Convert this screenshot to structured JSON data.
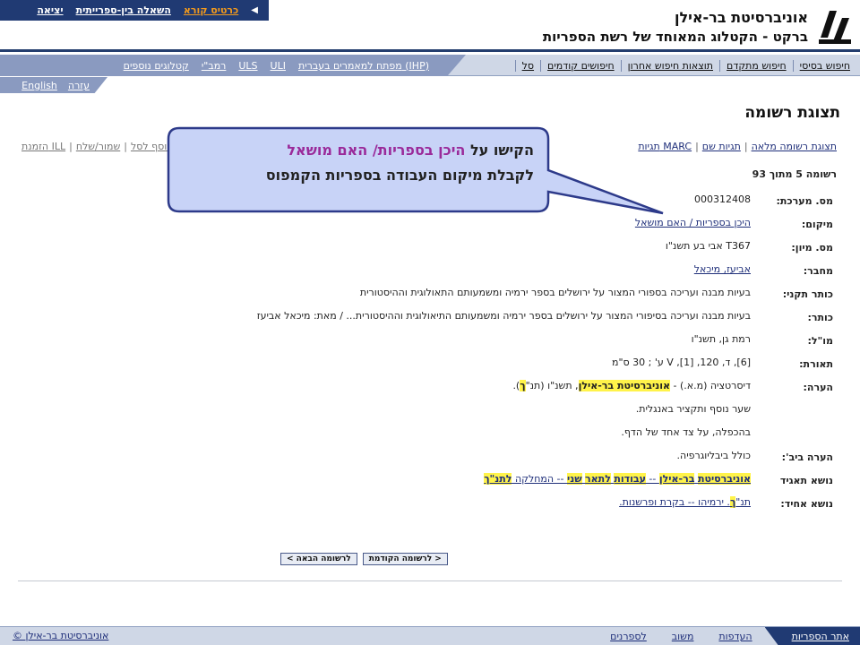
{
  "top_links": [
    {
      "label": "כרטיס קורא",
      "active": true
    },
    {
      "label": "השאלה בין-ספרייתית",
      "active": false
    },
    {
      "label": "יציאה",
      "active": false
    }
  ],
  "header": {
    "university": "אוניברסיטת בר-אילן",
    "subtitle": "ברקט - הקטלוג המאוחד של רשת הספריות"
  },
  "nav_right": [
    "חיפוש בסיסי",
    "חיפוש מתקדם",
    "תוצאות חיפוש אחרון",
    "חיפושים קודמים",
    "סל"
  ],
  "nav_left": [
    "מפתח למאמרים בעברית (IHP)",
    "ULI",
    "ULS",
    "רמב\"י",
    "קטלוגים נוספים"
  ],
  "lang_bar": [
    "עזרה",
    "English"
  ],
  "page_title": "תצוגת רשומה",
  "record_actions": [
    "תצוגת רשומה מלאה",
    "תגיות שם",
    "תגיות MARC"
  ],
  "record_actions_left": [
    "הזמנת ILL",
    "שמור/שלח",
    "הוסף לסל"
  ],
  "record_count": "רשומה 5 מתוך 93",
  "fields": [
    {
      "label": "מס. מערכת:",
      "value": "000312408"
    },
    {
      "label": "מיקום:",
      "value": "היכן בספריות / האם מושאל",
      "link": true
    },
    {
      "label": "מס. מיון:",
      "value": "T367 אבי בע תשנ\"ו"
    },
    {
      "label": "מחבר:",
      "value": "אביעז, מיכאל",
      "link": true
    },
    {
      "label": "כותר תקני:",
      "value": "בעיות מבנה ועריכה בספורי המצור על ירושלים בספר ירמיה ומשמעותם התאולוגית וההיסטורית"
    },
    {
      "label": "כותר:",
      "value": "בעיות מבנה ועריכה בסיפורי המצור על ירושלים בספר ירמיה ומשמעותם התיאולוגית וההיסטורית... / מאת: מיכאל אביעז"
    },
    {
      "label": "מו\"ל:",
      "value": "רמת גן, תשנ\"ו"
    },
    {
      "label": "תאורת:",
      "value": "[6], ד, 120, [1], V ע' ; 30 ס\"מ"
    }
  ],
  "note": {
    "label": "הערה:",
    "line1_pre": "דיסרטציה (מ.א.) - ",
    "line1_hl": "אוניברסיטת בר-אילן",
    "line1_mid": ", תשנ\"ו (תנ\"",
    "line1_hl2": "ך",
    "line1_post": ").",
    "line2": "שער נוסף ותקציר באנגלית.",
    "line3": "בהכפלה, על צד אחד של הדף."
  },
  "bib_note": {
    "label": "הערה ביב':",
    "value": "כולל ביבליוגרפיה."
  },
  "corp_subject": {
    "label": "נושא תאגיד",
    "p1": "אוניברסיטת",
    "p2": "בר-אילן",
    "p3": " -- ",
    "p4": "עבודות",
    "p5": "לתאר",
    "p6": "שני",
    "p7": " -- המחלקה ",
    "p8": "לתנ\"ך"
  },
  "uniform_subject": {
    "label": "נושא אחיד:",
    "pre": "תנ\"",
    "hl": "ך",
    "post": ". ירמיהו -- בקרת ופרשנות."
  },
  "pager": {
    "prev": "< לרשומה הקודמת",
    "next": "לרשומה הבאה >"
  },
  "footer": [
    "אתר הספריות",
    "העדפות",
    "משוב",
    "לספרנים"
  ],
  "copyright": "© אוניברסיטת בר-אילן",
  "callout": {
    "pre": "הקישו על ",
    "highlight": "היכן בספריות/ האם מושאל",
    "line2": "לקבלת מיקום העבודה בספריות הקמפוס"
  },
  "colors": {
    "brand_dark": "#203a73",
    "accent_orange": "#f39a1c",
    "highlight": "#fff34a",
    "callout_bg": "#c8d3f7"
  }
}
